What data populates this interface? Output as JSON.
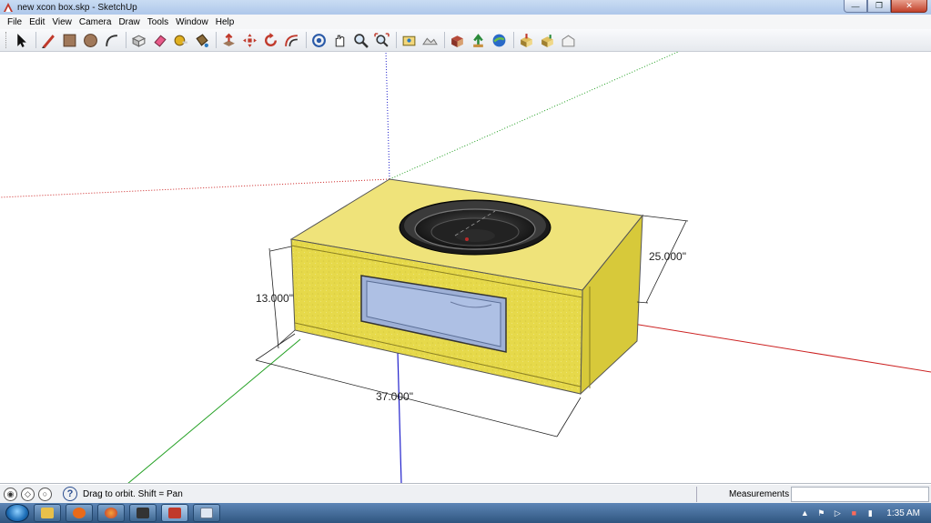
{
  "window": {
    "title": "new xcon box.skp - SketchUp",
    "app_icon": "sketchup-icon",
    "controls": {
      "minimize": "minimize-icon",
      "restore": "restore-icon",
      "close": "close-icon"
    }
  },
  "menu": {
    "items": [
      "File",
      "Edit",
      "View",
      "Camera",
      "Draw",
      "Tools",
      "Window",
      "Help"
    ]
  },
  "toolbar": {
    "groups": [
      [
        "select-arrow-icon"
      ],
      [
        "pencil-line-icon",
        "rectangle-icon",
        "circle-icon",
        "arc-icon"
      ],
      [
        "make-component-icon",
        "eraser-icon",
        "tape-measure-icon",
        "paint-bucket-icon"
      ],
      [
        "push-pull-icon",
        "move-icon",
        "rotate-icon",
        "offset-icon"
      ],
      [
        "orbit-icon",
        "pan-icon",
        "zoom-icon",
        "zoom-extents-icon"
      ],
      [
        "add-location-icon",
        "toggle-terrain-icon"
      ],
      [
        "get-models-icon",
        "share-model-icon",
        "google-earth-icon"
      ],
      [
        "get-components-icon",
        "share-component-icon",
        "warehouse-icon"
      ]
    ]
  },
  "viewport": {
    "dimensions": {
      "height": "13.000\"",
      "depth": "25.000\"",
      "width": "37.000\""
    },
    "colors": {
      "box_face": "#e6d94a",
      "box_top": "#efe37a",
      "box_side": "#d7c93a",
      "port": "#9eb0d6",
      "sub_outer": "#2b2b2b",
      "axis_red": "#cc2222",
      "axis_green": "#22a022",
      "axis_blue": "#2222cc"
    }
  },
  "status": {
    "icons": [
      "geo-location-icon",
      "credits-icon",
      "user-icon"
    ],
    "help_icon": "help-icon",
    "help_glyph": "?",
    "text": "Drag to orbit.  Shift = Pan",
    "measurements_label": "Measurements",
    "measurements_value": ""
  },
  "taskbar": {
    "apps": [
      "explorer-icon",
      "media-player-icon",
      "firefox-icon",
      "app-icon",
      "sketchup-icon",
      "notepad-icon"
    ],
    "active_index": 4,
    "tray_icons": [
      "show-hidden-icon",
      "flag-icon",
      "volume-icon",
      "network-alert-icon",
      "signal-icon"
    ],
    "time": "1:35 AM"
  }
}
